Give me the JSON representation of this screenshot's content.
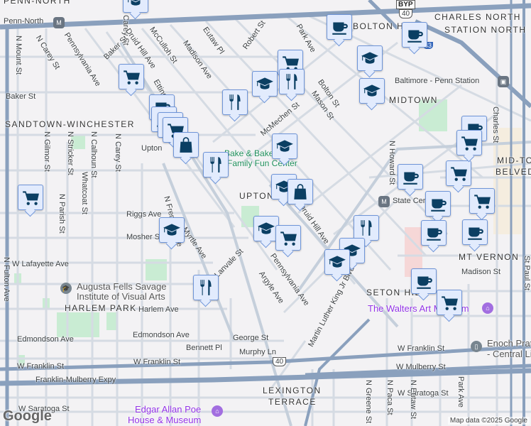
{
  "neighborhoods": [
    "PENN-NORTH",
    "BOLTON HILL",
    "CHARLES NORTH",
    "STATION NORTH",
    "MIDTOWN",
    "SANDTOWN-WINCHESTER",
    "UPTON",
    "MID-TOWN",
    "BELVEDERE",
    "MT VERNON",
    "SETON HILL",
    "HARLEM PARK",
    "LEXINGTON",
    "TERRACE"
  ],
  "streets": [
    "N Mount St",
    "N Carey St",
    "Pennsylvania Ave",
    "Baker St",
    "Druid Hill Ave",
    "McCulloh St",
    "Madison Ave",
    "Eutaw Pl",
    "Robert St",
    "Park Ave",
    "Bolton St",
    "Mason St",
    "McMechen St",
    "Baker St",
    "Etting St",
    "Upton",
    "N Gilmor St",
    "N Stricker St",
    "N Calhoun St",
    "Whatcoat St",
    "N Carey St",
    "N Parish St",
    "Riggs Ave",
    "Mosher St",
    "Myrtle Ave",
    "N Fremont Ave",
    "W Lafayette Ave",
    "N Fulton Ave",
    "Lanvale St",
    "Argyle Ave",
    "Harlem Ave",
    "Edmondson Ave",
    "George St",
    "Bennett Pl",
    "Murphy Ln",
    "W Franklin St",
    "W Franklin St",
    "Franklin-Mulberry Expy",
    "W Mulberry St",
    "W Saratoga St",
    "N Greene St",
    "N Paca St",
    "N Eutaw St",
    "Martin Luther King Jr Blvd",
    "N Howard St",
    "Charles St",
    "St Paul St",
    "Madison St",
    "Park Ave",
    "Pennsylvania Ave",
    "Druid Hill Ave"
  ],
  "pois": {
    "penn_north": "Penn-North",
    "penn_station": "Baltimore - Penn Station",
    "state_center": "State Center",
    "bake": "Bake & Bake",
    "bake2": "Family Fun Center",
    "augusta1": "Augusta Fells Savage",
    "augusta2": "Institute of Visual Arts",
    "walters": "The Walters Art Museum",
    "poe1": "Edgar Allan Poe",
    "poe2": "House & Museum",
    "enoch1": "Enoch Pratt",
    "enoch2": "- Central Library"
  },
  "shields": {
    "us40": "40",
    "i83": "83",
    "byp": "BYP"
  },
  "markers": [
    "cap",
    "cup",
    "cup",
    "cart",
    "cap",
    "cart",
    "cap",
    "fork",
    "cap",
    "fork",
    "cup",
    "cup",
    "cup",
    "cart",
    "bag",
    "cap",
    "fork",
    "cap",
    "bag",
    "cart",
    "cup",
    "cup",
    "cart",
    "cup",
    "cart",
    "cart",
    "cup",
    "cup",
    "cap",
    "cap",
    "cart",
    "fork",
    "cap",
    "cap",
    "cup",
    "cart",
    "fork"
  ],
  "colors": {
    "marker_icon": "#0b3f63",
    "marker_bg": "#e2ebfd",
    "highway": "#8aa0bd"
  },
  "footer": {
    "logo": "Google",
    "credit": "Map data ©2025 Google"
  }
}
